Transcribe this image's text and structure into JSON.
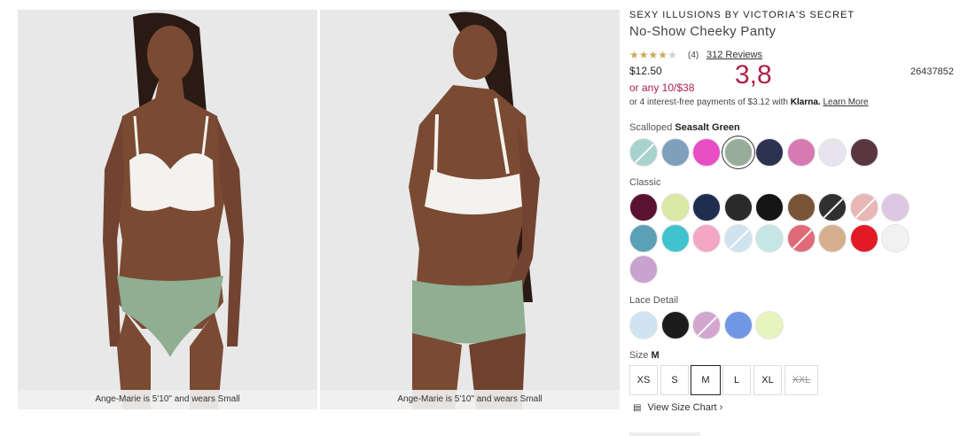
{
  "gallery": {
    "captions": [
      "Ange-Marie is 5'10\" and wears Small",
      "Ange-Marie is 5'10\" and wears Small"
    ]
  },
  "product": {
    "brand": "SEXY ILLUSIONS BY VICTORIA'S SECRET",
    "title": "No-Show Cheeky Panty",
    "rating_stars": "★★★★",
    "rating_empty_star": "★",
    "rating_count": "(4)",
    "reviews_link": "312 Reviews",
    "price": "$12.50",
    "offer": "or any 10/$38",
    "overlay_number": "3,8",
    "sku": "26437852",
    "klarna_text": "or 4 interest-free payments of $3.12 with",
    "klarna_brand": "Klarna.",
    "klarna_link": "Learn More"
  },
  "colors": {
    "scalloped": {
      "label_prefix": "Scalloped",
      "selected_name": "Seasalt Green",
      "swatches": [
        {
          "name": "mint-slash",
          "color": "#a8d2cd",
          "slash": true
        },
        {
          "name": "blue-gray",
          "color": "#7fa0bd"
        },
        {
          "name": "pink",
          "color": "#e84ec4"
        },
        {
          "name": "seasalt-green",
          "color": "#97ad9a",
          "selected": true
        },
        {
          "name": "navy-floral",
          "color": "#2b3350"
        },
        {
          "name": "pink-leopard",
          "color": "#d77ab3"
        },
        {
          "name": "white-floral",
          "color": "#e7e4ef"
        },
        {
          "name": "dark-floral",
          "color": "#5a3640"
        }
      ]
    },
    "classic": {
      "label": "Classic",
      "swatches": [
        {
          "name": "burgundy",
          "color": "#5b1230"
        },
        {
          "name": "lime",
          "color": "#dce9a4"
        },
        {
          "name": "navy",
          "color": "#1f2d50"
        },
        {
          "name": "black-dot",
          "color": "#2a2a2a"
        },
        {
          "name": "black",
          "color": "#151515"
        },
        {
          "name": "leopard",
          "color": "#7a5436"
        },
        {
          "name": "black-print-slash",
          "color": "#303030",
          "slash": true
        },
        {
          "name": "pink-print-slash",
          "color": "#e9b7b7",
          "slash": true
        },
        {
          "name": "lavender-tie-dye",
          "color": "#dec7e3"
        },
        {
          "name": "blue-leopard",
          "color": "#5ca0b5"
        },
        {
          "name": "aqua",
          "color": "#3fc4cf"
        },
        {
          "name": "pink-stripe",
          "color": "#f3a7c4"
        },
        {
          "name": "light-blue-slash",
          "color": "#d0e4ef",
          "slash": true
        },
        {
          "name": "pastel-tie-dye",
          "color": "#c5e6e4"
        },
        {
          "name": "red-floral-slash",
          "color": "#e06a77",
          "slash": true
        },
        {
          "name": "nude",
          "color": "#d6b08e"
        },
        {
          "name": "red",
          "color": "#e11a25"
        },
        {
          "name": "white",
          "color": "#f1f1f1"
        },
        {
          "name": "orchid",
          "color": "#c8a3cf"
        }
      ]
    },
    "lace": {
      "label": "Lace Detail",
      "swatches": [
        {
          "name": "light-blue",
          "color": "#cfe4f0"
        },
        {
          "name": "black-lace",
          "color": "#1c1c1c"
        },
        {
          "name": "pink-purple-slash",
          "color": "#d2a6cf",
          "slash": true
        },
        {
          "name": "cornflower",
          "color": "#6f97e3"
        },
        {
          "name": "pale-lime",
          "color": "#e6f4bd"
        }
      ]
    }
  },
  "size": {
    "label": "Size",
    "selected": "M",
    "options": [
      {
        "label": "XS"
      },
      {
        "label": "S"
      },
      {
        "label": "M",
        "selected": true
      },
      {
        "label": "L"
      },
      {
        "label": "XL"
      },
      {
        "label": "XXL",
        "oos": true
      }
    ],
    "size_chart_link": "View Size Chart"
  }
}
